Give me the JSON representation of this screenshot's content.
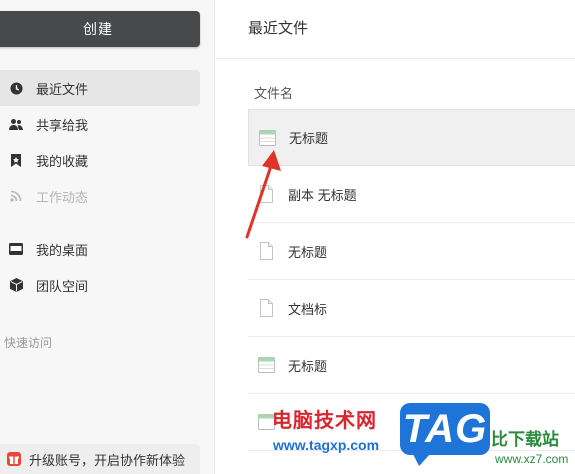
{
  "sidebar": {
    "create_label": "创建",
    "items": [
      {
        "label": "最近文件",
        "icon": "clock-icon",
        "state": "active"
      },
      {
        "label": "共享给我",
        "icon": "people-icon",
        "state": "normal"
      },
      {
        "label": "我的收藏",
        "icon": "bookmark-icon",
        "state": "normal"
      },
      {
        "label": "工作动态",
        "icon": "rss-icon",
        "state": "disabled"
      },
      {
        "label": "我的桌面",
        "icon": "desktop-icon",
        "state": "normal"
      },
      {
        "label": "团队空间",
        "icon": "cube-icon",
        "state": "normal"
      }
    ],
    "quick_access_label": "快速访问",
    "upgrade_label": "升级账号，开启协作新体验"
  },
  "main": {
    "title": "最近文件",
    "column_header": "文件名",
    "files": [
      {
        "name": "无标题",
        "icon": "sheet-icon"
      },
      {
        "name": "副本 无标题",
        "icon": "doc-icon"
      },
      {
        "name": "无标题",
        "icon": "doc-icon"
      },
      {
        "name": "文档标",
        "icon": "doc-icon"
      },
      {
        "name": "无标题",
        "icon": "sheet-icon"
      }
    ]
  },
  "watermark": {
    "cn_text": "电脑技术网",
    "url": "www.tagxp.com",
    "tag": "TAG",
    "site_text": "比下载站",
    "site_url": "www.xz7.com"
  },
  "colors": {
    "create_button": "#47494b",
    "active_item": "#e6e6e6",
    "annotation_arrow": "#e0332a"
  }
}
